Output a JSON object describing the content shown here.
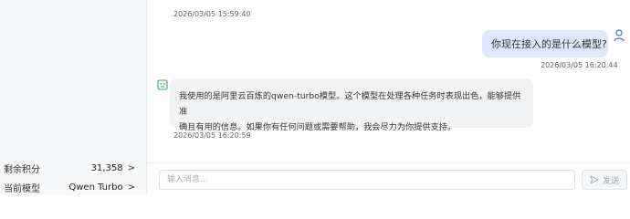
{
  "sidebar": {
    "credits": {
      "label": "剩余积分",
      "value": "31,358",
      "chevron": ">"
    },
    "model": {
      "label": "当前模型",
      "value": "Qwen Turbo",
      "chevron": ">"
    }
  },
  "chat": {
    "top_timestamp": "2026/03/05 15:59:40",
    "messages": [
      {
        "role": "user",
        "text": "你现在接入的是什么模型?",
        "timestamp": "2026/03/05 16:20:44"
      },
      {
        "role": "assistant",
        "line1": "我使用的是阿里云百炼的qwen-turbo模型。这个模型在处理各种任务时表现出色，能够提供准",
        "line2": "确且有用的信息。如果你有任何问题或需要帮助，我会尽力为你提供支持。",
        "timestamp": "2026/03/05 16:20:59"
      }
    ]
  },
  "composer": {
    "placeholder": "输入消息...",
    "send_label": "发送"
  },
  "colors": {
    "user_bubble": "#dde9fa",
    "assistant_bubble": "#f1f2f4",
    "user_icon": "#3d6fd8",
    "bot_icon": "#3aa66a"
  }
}
